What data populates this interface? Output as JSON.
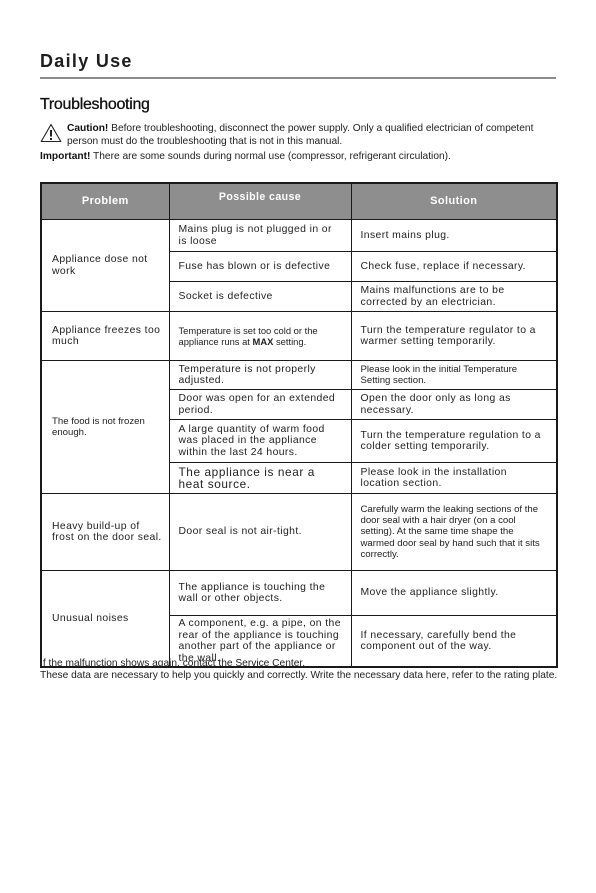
{
  "chapter": {
    "title": "Daily Use"
  },
  "section": {
    "title": "Troubleshooting"
  },
  "notes": {
    "caution_label": "Caution!",
    "caution_text": " Before troubleshooting, disconnect the power supply. Only a qualified electrician of competent person must do the troubleshooting that is not in this manual.",
    "caution_icon": "warning-triangle-icon",
    "important_label": "Important!",
    "important_text": " There are some sounds during normal use (compressor, refrigerant circulation)."
  },
  "table": {
    "headers": {
      "problem": "Problem",
      "cause": "Possible cause",
      "solution": "Solution"
    },
    "groups": [
      {
        "problem": "Appliance dose not work",
        "rows": [
          {
            "cause": "Mains plug is not plugged in or is loose",
            "solution": "Insert mains plug."
          },
          {
            "cause": "Fuse has blown or is defective",
            "solution": "Check fuse, replace if necessary."
          },
          {
            "cause": "Socket is defective",
            "solution": "Mains malfunctions are to be corrected by an electrician."
          }
        ]
      },
      {
        "problem": "Appliance freezes too much",
        "rows": [
          {
            "cause_prefix": "Temperature is set too cold or the appliance runs at ",
            "cause_bold": "MAX",
            "cause_suffix": " setting.",
            "solution": "Turn the temperature regulator to a warmer setting temporarily."
          }
        ]
      },
      {
        "problem": "The food is not frozen enough.",
        "rows": [
          {
            "cause": "Temperature is not properly adjusted.",
            "solution": "Please look in the initial Temperature Setting section."
          },
          {
            "cause": "Door was open for an extended period.",
            "solution": "Open the door only as long as necessary."
          },
          {
            "cause": "A large quantity of warm food was placed in the appliance within the last 24 hours.",
            "solution": "Turn the temperature regulation to a colder setting temporarily."
          },
          {
            "cause": "The appliance is near a heat source.",
            "solution": "Please look in the installation location section."
          }
        ]
      },
      {
        "problem": "Heavy build-up of frost on the door seal.",
        "rows": [
          {
            "cause": "Door seal is not air-tight.",
            "solution": "Carefully warm the leaking sections of the door seal with a hair dryer (on a cool setting). At the same time shape the warmed door seal by hand such that it sits correctly."
          }
        ]
      },
      {
        "problem": "Unusual noises",
        "rows": [
          {
            "cause": "The appliance is touching the wall or other objects.",
            "solution": "Move the appliance slightly."
          },
          {
            "cause": "A component, e.g. a pipe, on the rear of the appliance is touching another part of the appliance or the wall.",
            "solution": "If necessary, carefully bend the component out of the way."
          }
        ]
      }
    ]
  },
  "footer": {
    "line1": "If the malfunction shows again, contact the Service Center.",
    "line2": "These data are necessary to help you quickly and correctly. Write the necessary data here, refer to the rating plate."
  }
}
